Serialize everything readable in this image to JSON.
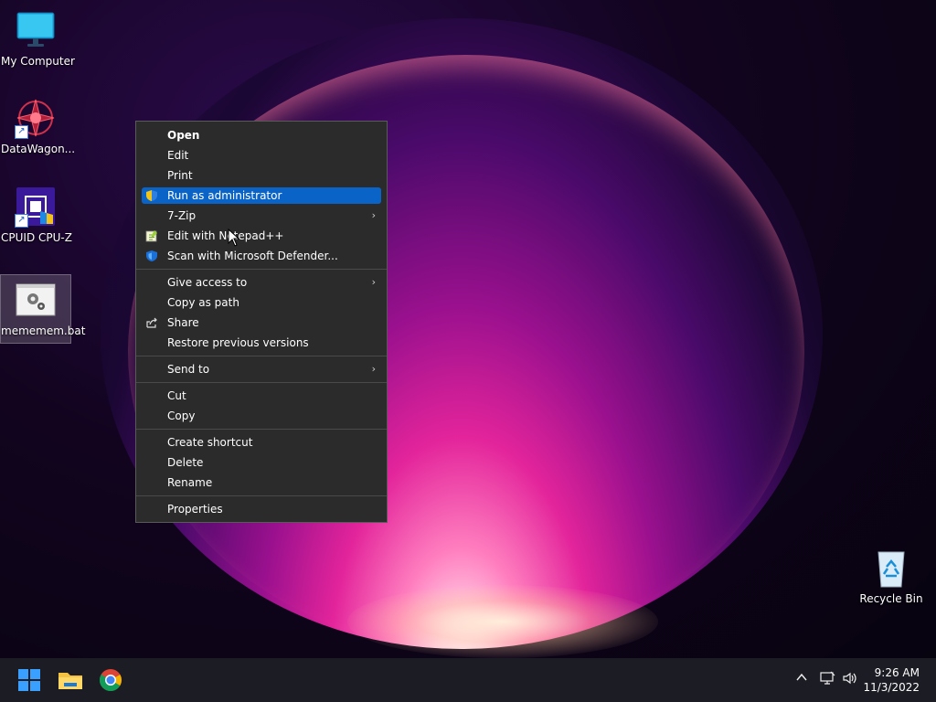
{
  "desktop": {
    "icons": [
      {
        "label": "My Computer"
      },
      {
        "label": "DataWagon..."
      },
      {
        "label": "CPUID CPU-Z"
      },
      {
        "label": "mememem.bat"
      },
      {
        "label": "Recycle Bin"
      }
    ]
  },
  "context_menu": {
    "items": [
      {
        "label": "Open"
      },
      {
        "label": "Edit"
      },
      {
        "label": "Print"
      },
      {
        "label": "Run as administrator"
      },
      {
        "label": "7-Zip"
      },
      {
        "label": "Edit with Notepad++"
      },
      {
        "label": "Scan with Microsoft Defender..."
      },
      {
        "label": "Give access to"
      },
      {
        "label": "Copy as path"
      },
      {
        "label": "Share"
      },
      {
        "label": "Restore previous versions"
      },
      {
        "label": "Send to"
      },
      {
        "label": "Cut"
      },
      {
        "label": "Copy"
      },
      {
        "label": "Create shortcut"
      },
      {
        "label": "Delete"
      },
      {
        "label": "Rename"
      },
      {
        "label": "Properties"
      }
    ],
    "submenu_arrow": "›",
    "highlight_color": "#0a64c8"
  },
  "taskbar": {
    "time": "9:26 AM",
    "date": "11/3/2022",
    "tray_chevron": "^"
  }
}
